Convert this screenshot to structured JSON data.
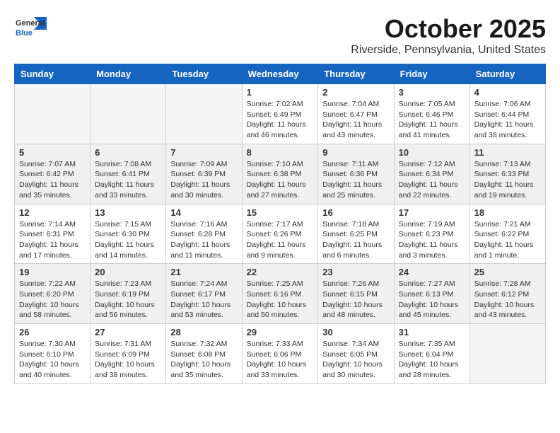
{
  "logo": {
    "general": "General",
    "blue": "Blue"
  },
  "title": "October 2025",
  "location": "Riverside, Pennsylvania, United States",
  "days_of_week": [
    "Sunday",
    "Monday",
    "Tuesday",
    "Wednesday",
    "Thursday",
    "Friday",
    "Saturday"
  ],
  "weeks": [
    [
      {
        "day": "",
        "info": ""
      },
      {
        "day": "",
        "info": ""
      },
      {
        "day": "",
        "info": ""
      },
      {
        "day": "1",
        "info": "Sunrise: 7:02 AM\nSunset: 6:49 PM\nDaylight: 11 hours\nand 46 minutes."
      },
      {
        "day": "2",
        "info": "Sunrise: 7:04 AM\nSunset: 6:47 PM\nDaylight: 11 hours\nand 43 minutes."
      },
      {
        "day": "3",
        "info": "Sunrise: 7:05 AM\nSunset: 6:46 PM\nDaylight: 11 hours\nand 41 minutes."
      },
      {
        "day": "4",
        "info": "Sunrise: 7:06 AM\nSunset: 6:44 PM\nDaylight: 11 hours\nand 38 minutes."
      }
    ],
    [
      {
        "day": "5",
        "info": "Sunrise: 7:07 AM\nSunset: 6:42 PM\nDaylight: 11 hours\nand 35 minutes."
      },
      {
        "day": "6",
        "info": "Sunrise: 7:08 AM\nSunset: 6:41 PM\nDaylight: 11 hours\nand 33 minutes."
      },
      {
        "day": "7",
        "info": "Sunrise: 7:09 AM\nSunset: 6:39 PM\nDaylight: 11 hours\nand 30 minutes."
      },
      {
        "day": "8",
        "info": "Sunrise: 7:10 AM\nSunset: 6:38 PM\nDaylight: 11 hours\nand 27 minutes."
      },
      {
        "day": "9",
        "info": "Sunrise: 7:11 AM\nSunset: 6:36 PM\nDaylight: 11 hours\nand 25 minutes."
      },
      {
        "day": "10",
        "info": "Sunrise: 7:12 AM\nSunset: 6:34 PM\nDaylight: 11 hours\nand 22 minutes."
      },
      {
        "day": "11",
        "info": "Sunrise: 7:13 AM\nSunset: 6:33 PM\nDaylight: 11 hours\nand 19 minutes."
      }
    ],
    [
      {
        "day": "12",
        "info": "Sunrise: 7:14 AM\nSunset: 6:31 PM\nDaylight: 11 hours\nand 17 minutes."
      },
      {
        "day": "13",
        "info": "Sunrise: 7:15 AM\nSunset: 6:30 PM\nDaylight: 11 hours\nand 14 minutes."
      },
      {
        "day": "14",
        "info": "Sunrise: 7:16 AM\nSunset: 6:28 PM\nDaylight: 11 hours\nand 11 minutes."
      },
      {
        "day": "15",
        "info": "Sunrise: 7:17 AM\nSunset: 6:26 PM\nDaylight: 11 hours\nand 9 minutes."
      },
      {
        "day": "16",
        "info": "Sunrise: 7:18 AM\nSunset: 6:25 PM\nDaylight: 11 hours\nand 6 minutes."
      },
      {
        "day": "17",
        "info": "Sunrise: 7:19 AM\nSunset: 6:23 PM\nDaylight: 11 hours\nand 3 minutes."
      },
      {
        "day": "18",
        "info": "Sunrise: 7:21 AM\nSunset: 6:22 PM\nDaylight: 11 hours\nand 1 minute."
      }
    ],
    [
      {
        "day": "19",
        "info": "Sunrise: 7:22 AM\nSunset: 6:20 PM\nDaylight: 10 hours\nand 58 minutes."
      },
      {
        "day": "20",
        "info": "Sunrise: 7:23 AM\nSunset: 6:19 PM\nDaylight: 10 hours\nand 56 minutes."
      },
      {
        "day": "21",
        "info": "Sunrise: 7:24 AM\nSunset: 6:17 PM\nDaylight: 10 hours\nand 53 minutes."
      },
      {
        "day": "22",
        "info": "Sunrise: 7:25 AM\nSunset: 6:16 PM\nDaylight: 10 hours\nand 50 minutes."
      },
      {
        "day": "23",
        "info": "Sunrise: 7:26 AM\nSunset: 6:15 PM\nDaylight: 10 hours\nand 48 minutes."
      },
      {
        "day": "24",
        "info": "Sunrise: 7:27 AM\nSunset: 6:13 PM\nDaylight: 10 hours\nand 45 minutes."
      },
      {
        "day": "25",
        "info": "Sunrise: 7:28 AM\nSunset: 6:12 PM\nDaylight: 10 hours\nand 43 minutes."
      }
    ],
    [
      {
        "day": "26",
        "info": "Sunrise: 7:30 AM\nSunset: 6:10 PM\nDaylight: 10 hours\nand 40 minutes."
      },
      {
        "day": "27",
        "info": "Sunrise: 7:31 AM\nSunset: 6:09 PM\nDaylight: 10 hours\nand 38 minutes."
      },
      {
        "day": "28",
        "info": "Sunrise: 7:32 AM\nSunset: 6:08 PM\nDaylight: 10 hours\nand 35 minutes."
      },
      {
        "day": "29",
        "info": "Sunrise: 7:33 AM\nSunset: 6:06 PM\nDaylight: 10 hours\nand 33 minutes."
      },
      {
        "day": "30",
        "info": "Sunrise: 7:34 AM\nSunset: 6:05 PM\nDaylight: 10 hours\nand 30 minutes."
      },
      {
        "day": "31",
        "info": "Sunrise: 7:35 AM\nSunset: 6:04 PM\nDaylight: 10 hours\nand 28 minutes."
      },
      {
        "day": "",
        "info": ""
      }
    ]
  ]
}
